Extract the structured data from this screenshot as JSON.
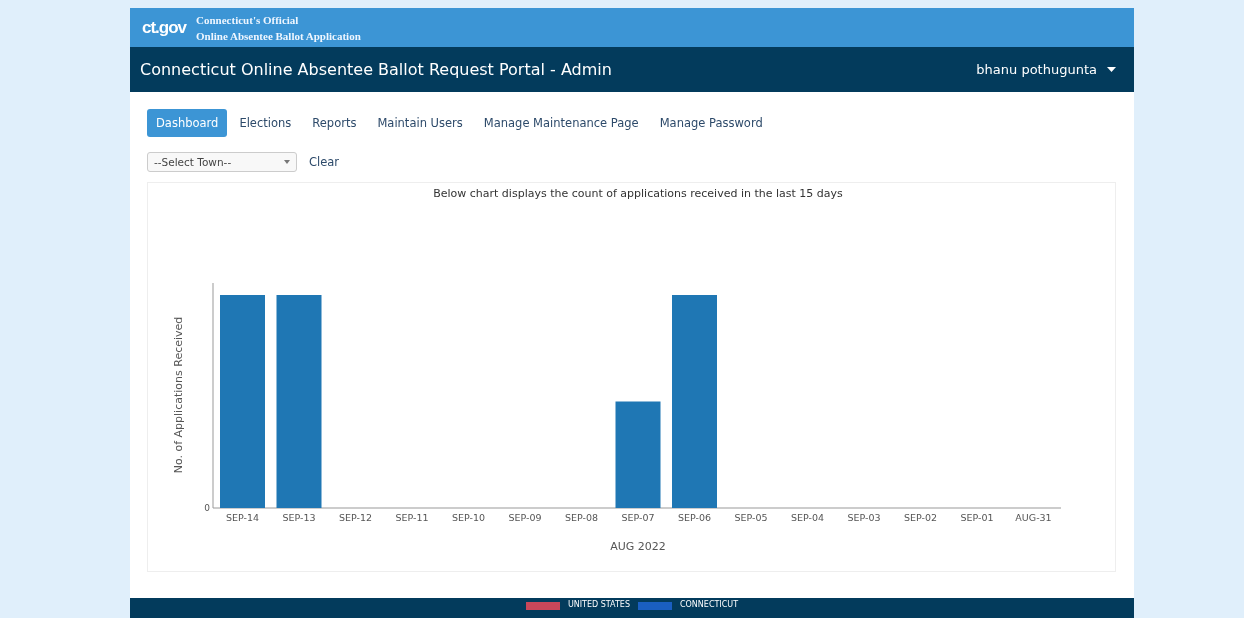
{
  "header": {
    "logo": "ct.gov",
    "line_1": "Connecticut's Official",
    "line_2": "Online Absentee Ballot Application"
  },
  "navbar": {
    "title": "Connecticut Online Absentee Ballot Request Portal - Admin",
    "user": "bhanu pothugunta"
  },
  "tabs": [
    {
      "label": "Dashboard",
      "selected": true
    },
    {
      "label": "Elections",
      "selected": false
    },
    {
      "label": "Reports",
      "selected": false
    },
    {
      "label": "Maintain Users",
      "selected": false
    },
    {
      "label": "Manage Maintenance Page",
      "selected": false
    },
    {
      "label": "Manage Password",
      "selected": false
    }
  ],
  "town_select": {
    "value": "--Select Town--"
  },
  "clear_link": "Clear",
  "chart": {
    "title": "Below chart displays the count of applications received in the last 15 days",
    "ylabel": "No. of Applications Received",
    "ytick": "0",
    "xlabel": "AUG 2022",
    "categories": [
      "SEP-14",
      "SEP-13",
      "SEP-12",
      "SEP-11",
      "SEP-10",
      "SEP-09",
      "SEP-08",
      "SEP-07",
      "SEP-06",
      "SEP-05",
      "SEP-04",
      "SEP-03",
      "SEP-02",
      "SEP-01",
      "AUG-31"
    ]
  },
  "footer": {
    "items": [
      "UNITED STATES",
      "CONNECTICUT"
    ]
  }
}
